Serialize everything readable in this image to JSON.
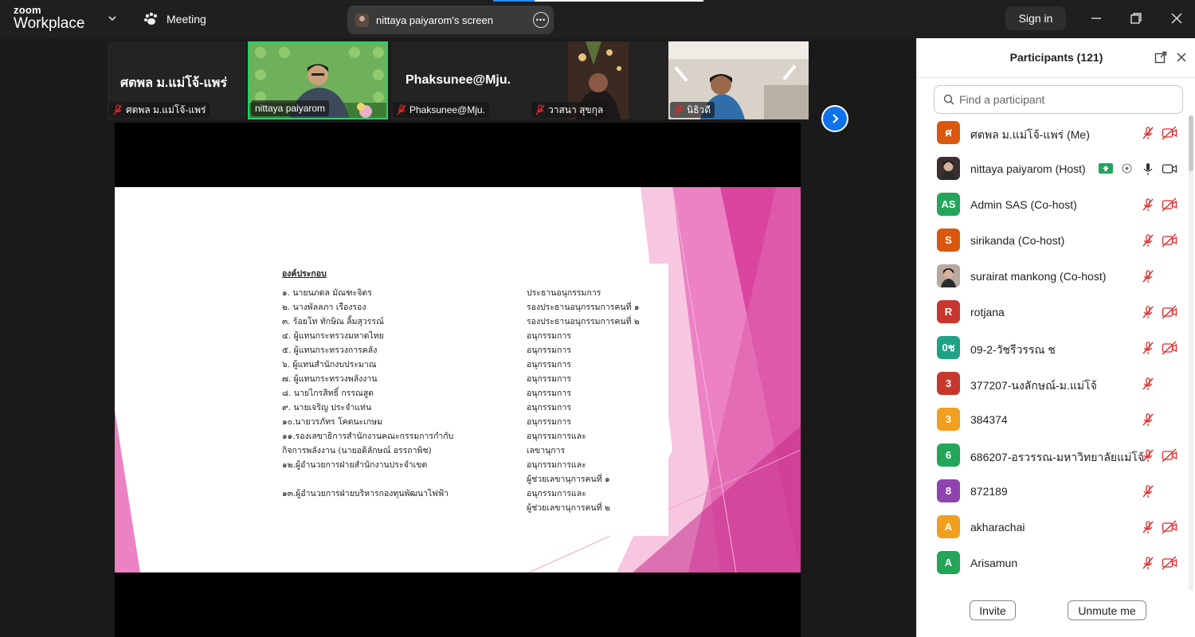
{
  "titlebar": {
    "brand_top": "zoom",
    "brand_bottom": "Workplace",
    "meeting_label": "Meeting",
    "screen_label": "nittaya paiyarom's screen",
    "signin_label": "Sign in",
    "more_icon": "more-icon",
    "colors": {
      "accent": "#2d8cff",
      "bar": "#1f1f1f"
    }
  },
  "strip": {
    "tiles": [
      {
        "big": "ศตพล ม.แม่โจ้-แพร่",
        "label": "ศตพล ม.แม่โจ้-แพร่",
        "muted": true
      },
      {
        "big": "",
        "label": "nittaya paiyarom",
        "muted": false,
        "active": true
      },
      {
        "big": "Phaksunee@Mju.",
        "label": "Phaksunee@Mju.",
        "muted": true
      },
      {
        "big": "",
        "label": "วาสนา สุขกุล",
        "muted": true
      },
      {
        "big": "",
        "label": "นิธิวดี",
        "muted": true
      }
    ]
  },
  "slide": {
    "heading": "องค์ประกอบ",
    "rows": [
      {
        "left": "๑.  นายนภดล        มัณฑะจิตร",
        "role": "ประธานอนุกรรมการ"
      },
      {
        "left": "๒.  นางพัลลภา        เรืองรอง",
        "role": "รองประธานอนุกรรมการคนที่ ๑"
      },
      {
        "left": "๓.  ร้อยโท ทักษิณ   ลิ้มสุวรรณ์",
        "role": "รองประธานอนุกรรมการคนที่ ๒"
      },
      {
        "left": "๔.  ผู้แทนกระทรวงมหาดไทย",
        "role": "อนุกรรมการ"
      },
      {
        "left": "๕.  ผู้แทนกระทรวงการคลัง",
        "role": "อนุกรรมการ"
      },
      {
        "left": "๖.  ผู้แทนสำนักงบประมาณ",
        "role": "อนุกรรมการ"
      },
      {
        "left": "๗.  ผู้แทนกระทรวงพลังงาน",
        "role": "อนุกรรมการ"
      },
      {
        "left": "๘.  นายไกรสิทธิ์        กรรณสูต",
        "role": "อนุกรรมการ"
      },
      {
        "left": "๙.  นายเจริญ           ประจำแท่น",
        "role": "อนุกรรมการ"
      },
      {
        "left": "๑๐.นายวรภัทร        โคตนะเกษม",
        "role": "อนุกรรมการ"
      },
      {
        "left": "๑๑.รองเลขาธิการสำนักงานคณะกรรมการกำกับ",
        "role": "อนุกรรมการและ"
      },
      {
        "left": "     กิจการพลังงาน (นายอดิลักษณ์  อรรถาพิช)",
        "role": "เลขานุการ"
      },
      {
        "left": "๑๒.ผู้อำนวยการฝ่ายสำนักงานประจำเขต",
        "role": "อนุกรรมการและ"
      },
      {
        "left": "",
        "role": "ผู้ช่วยเลขานุการคนที่ ๑"
      },
      {
        "left": "๑๓.ผู้อำนวยการฝ่ายบริหารกองทุนพัฒนาไฟฟ้า",
        "role": "อนุกรรมการและ"
      },
      {
        "left": "",
        "role": "ผู้ช่วยเลขานุการคนที่ ๒"
      }
    ]
  },
  "panel": {
    "title": "Participants (121)",
    "search_placeholder": "Find a participant",
    "participants": [
      {
        "initials": "ศ",
        "color": "#d9580d",
        "name": "ศตพล ม.แม่โจ้-แพร่ (Me)",
        "mic": "muted",
        "cam": "off"
      },
      {
        "initials": "",
        "color": "#3a3030",
        "name": "nittaya paiyarom (Host)",
        "mic": "on",
        "cam": "on",
        "photo": true,
        "sharing": true
      },
      {
        "initials": "AS",
        "color": "#23a55a",
        "name": "Admin SAS (Co-host)",
        "mic": "muted",
        "cam": "off"
      },
      {
        "initials": "S",
        "color": "#d9580d",
        "name": "sirikanda (Co-host)",
        "mic": "muted",
        "cam": "off"
      },
      {
        "initials": "",
        "color": "#b8a8a0",
        "name": "surairat mankong (Co-host)",
        "mic": "muted",
        "cam": "none",
        "photo": true
      },
      {
        "initials": "R",
        "color": "#c8372d",
        "name": " rotjana",
        "mic": "muted",
        "cam": "off"
      },
      {
        "initials": "0ช",
        "color": "#1fa385",
        "name": "09-2-วัชรีวรรณ ช",
        "mic": "muted",
        "cam": "off"
      },
      {
        "initials": "3",
        "color": "#c8372d",
        "name": "377207-นงลักษณ์-ม.แม่โจ้",
        "mic": "muted",
        "cam": "none"
      },
      {
        "initials": "3",
        "color": "#f0a01e",
        "name": "384374",
        "mic": "muted",
        "cam": "none"
      },
      {
        "initials": "6",
        "color": "#23a55a",
        "name": "686207-อรวรรณ-มหาวิทยาลัยแม่โจ้",
        "mic": "muted",
        "cam": "off"
      },
      {
        "initials": "8",
        "color": "#8e44ad",
        "name": "872189",
        "mic": "muted",
        "cam": "none"
      },
      {
        "initials": "A",
        "color": "#f0a01e",
        "name": "akharachai",
        "mic": "muted",
        "cam": "off"
      },
      {
        "initials": "A",
        "color": "#23a55a",
        "name": "Arisamun",
        "mic": "muted",
        "cam": "off"
      }
    ],
    "invite_label": "Invite",
    "unmute_label": "Unmute me"
  }
}
